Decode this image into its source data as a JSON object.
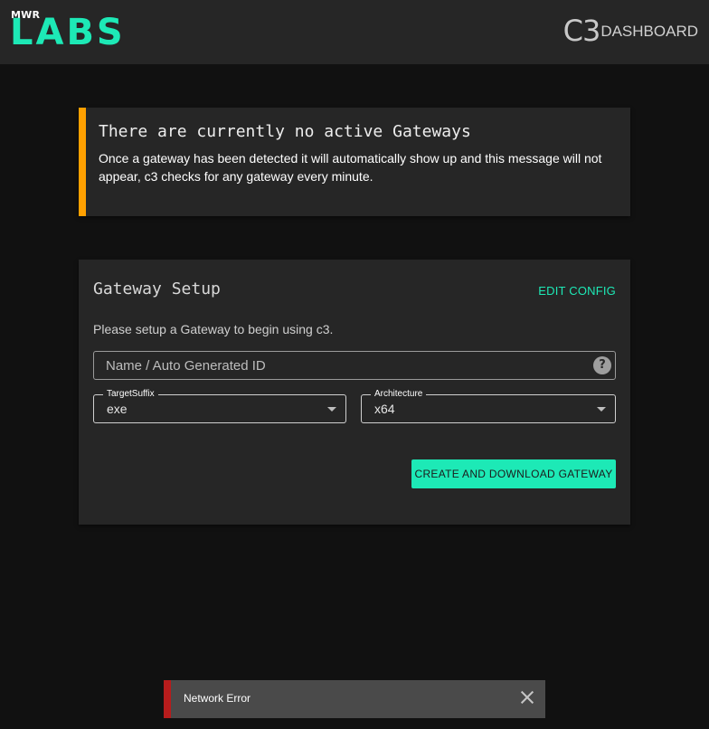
{
  "header": {
    "logo_small": "MWR",
    "logo_large": "LABS",
    "brand_c3": "C3",
    "brand_dashboard": "DASHBOARD",
    "accent_color": "#1de9b6"
  },
  "alert": {
    "title": "There are currently no active Gateways",
    "message": "Once a gateway has been detected it will automatically show up and this message will not appear, c3 checks for any gateway every minute.",
    "border_color": "#ffa000"
  },
  "setup": {
    "title": "Gateway Setup",
    "edit_config": "EDIT CONFIG",
    "description": "Please setup a Gateway to begin using c3.",
    "name_placeholder": "Name / Auto Generated ID",
    "help_icon": "help-circle-icon",
    "target_suffix": {
      "label": "TargetSuffix",
      "value": "exe"
    },
    "architecture": {
      "label": "Architecture",
      "value": "x64"
    },
    "create_button": "CREATE AND DOWNLOAD GATEWAY"
  },
  "snackbar": {
    "message": "Network Error",
    "close_icon": "close-icon",
    "border_color": "#b71c1c"
  }
}
